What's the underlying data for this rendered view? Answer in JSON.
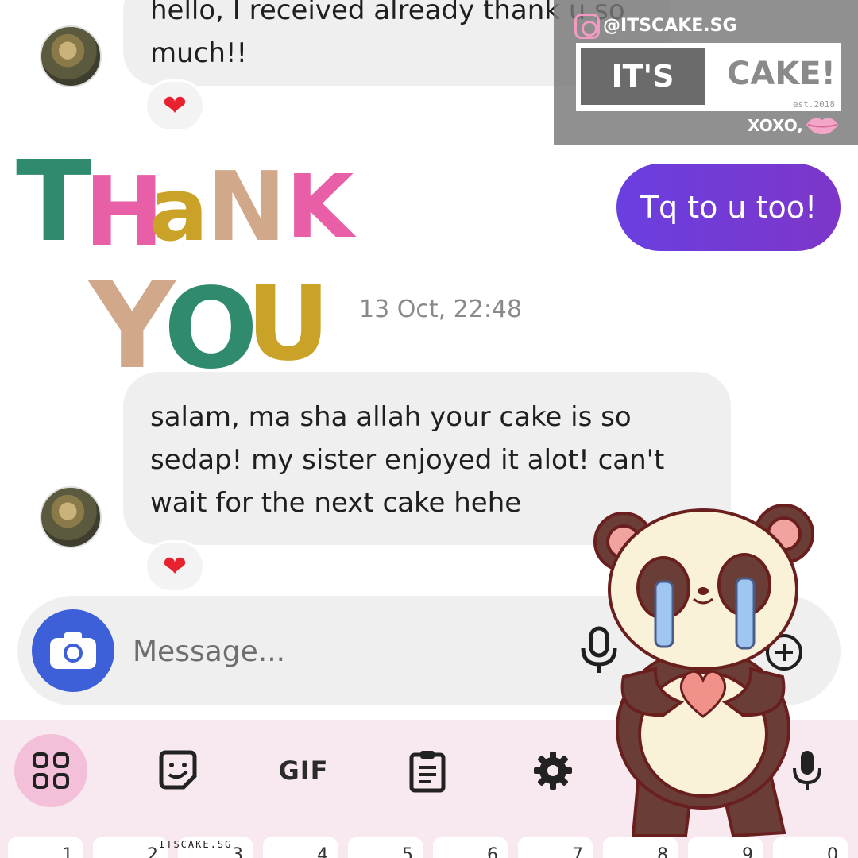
{
  "messages": {
    "previous": {
      "lines": [
        "hello, I received already thank u so",
        "much!!"
      ],
      "reaction": "❤"
    },
    "sent": {
      "text": "Tq to u too!"
    },
    "timestamp": "13 Oct, 22:48",
    "received": {
      "lines": [
        "salam, ma sha allah your cake is so",
        "sedap! my sister enjoyed it alot! can't",
        "wait for the next cake hehe"
      ],
      "reaction": "❤"
    }
  },
  "sticker_thank_you": {
    "line1": [
      "T",
      "H",
      "a",
      "N",
      "K"
    ],
    "line2": [
      "Y",
      "O",
      "U"
    ],
    "colors": [
      "#2f8a6e",
      "#e85fa8",
      "#c9a227",
      "#d1a88a"
    ]
  },
  "brand": {
    "handle": "@ITSCAKE.SG",
    "its": "IT'S",
    "cake": "CAKE!",
    "est": "est.2018",
    "signoff": "XOXO,"
  },
  "composer": {
    "placeholder": "Message...",
    "camera_icon": "camera-icon",
    "mic_icon": "microphone-icon",
    "add_icon": "plus-circle-icon"
  },
  "keyboard": {
    "tools": [
      "apps-grid-icon",
      "sticker-icon",
      "GIF",
      "clipboard-icon",
      "gear-icon",
      "microphone-icon"
    ],
    "gif_label": "GIF",
    "number_keys": [
      "1",
      "2",
      "3",
      "4",
      "5",
      "6",
      "7",
      "8",
      "9",
      "0"
    ]
  },
  "watermark": "ITSCAKE.SG",
  "colors": {
    "sent_bubble": "#6a3fe0",
    "camera_button": "#3d5fd8",
    "keyboard_bg": "#f8e8ef",
    "reaction": "#e8212e"
  }
}
